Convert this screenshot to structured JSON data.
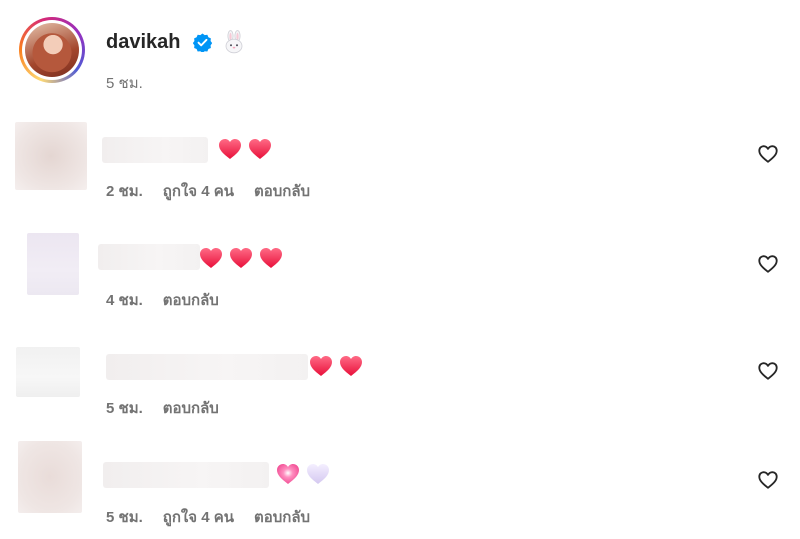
{
  "author": {
    "username": "davikah",
    "time": "5 ชม.",
    "verified": true,
    "badge_emoji_icon": "bunny-emoji-icon"
  },
  "comments": [
    {
      "time": "2 ชม.",
      "likes": "ถูกใจ 4 คน",
      "reply_label": "ตอบกลับ",
      "emojis": [
        "red-heart",
        "red-heart"
      ]
    },
    {
      "time": "4 ชม.",
      "likes": "",
      "reply_label": "ตอบกลับ",
      "emojis": [
        "red-heart",
        "red-heart",
        "red-heart"
      ]
    },
    {
      "time": "5 ชม.",
      "likes": "",
      "reply_label": "ตอบกลับ",
      "emojis": [
        "red-heart",
        "red-heart"
      ]
    },
    {
      "time": "5 ชม.",
      "likes": "ถูกใจ 4 คน",
      "reply_label": "ตอบกลับ",
      "emojis": [
        "pink-heart",
        "white-heart"
      ]
    }
  ],
  "colors": {
    "text_primary": "#262626",
    "text_secondary": "#737373",
    "verified_blue": "#0095f6",
    "heart_red": "#f4364c"
  }
}
